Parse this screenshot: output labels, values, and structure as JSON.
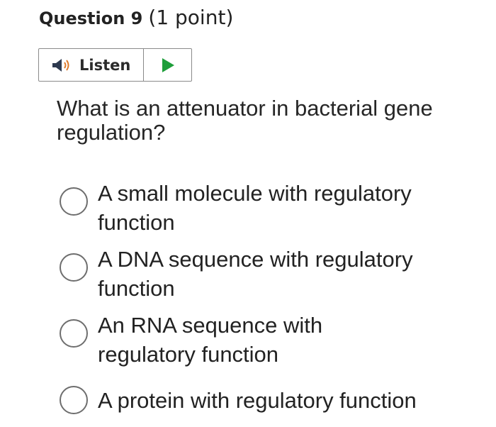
{
  "question": {
    "title": "Question 9",
    "points": "(1 point)",
    "text": "What is an attenuator in bacterial gene regulation?"
  },
  "listen": {
    "label": "Listen",
    "speaker_icon": "speaker-icon",
    "play_icon": "play-icon",
    "speaker_color": "#2e3a4f",
    "waves_color": "#e07b2a",
    "play_color": "#1e9e3a"
  },
  "options": [
    {
      "label": "A small molecule with regulatory function"
    },
    {
      "label": "A DNA sequence with regulatory function"
    },
    {
      "label": "An RNA sequence with regulatory function"
    },
    {
      "label": "A protein with regulatory function"
    }
  ]
}
